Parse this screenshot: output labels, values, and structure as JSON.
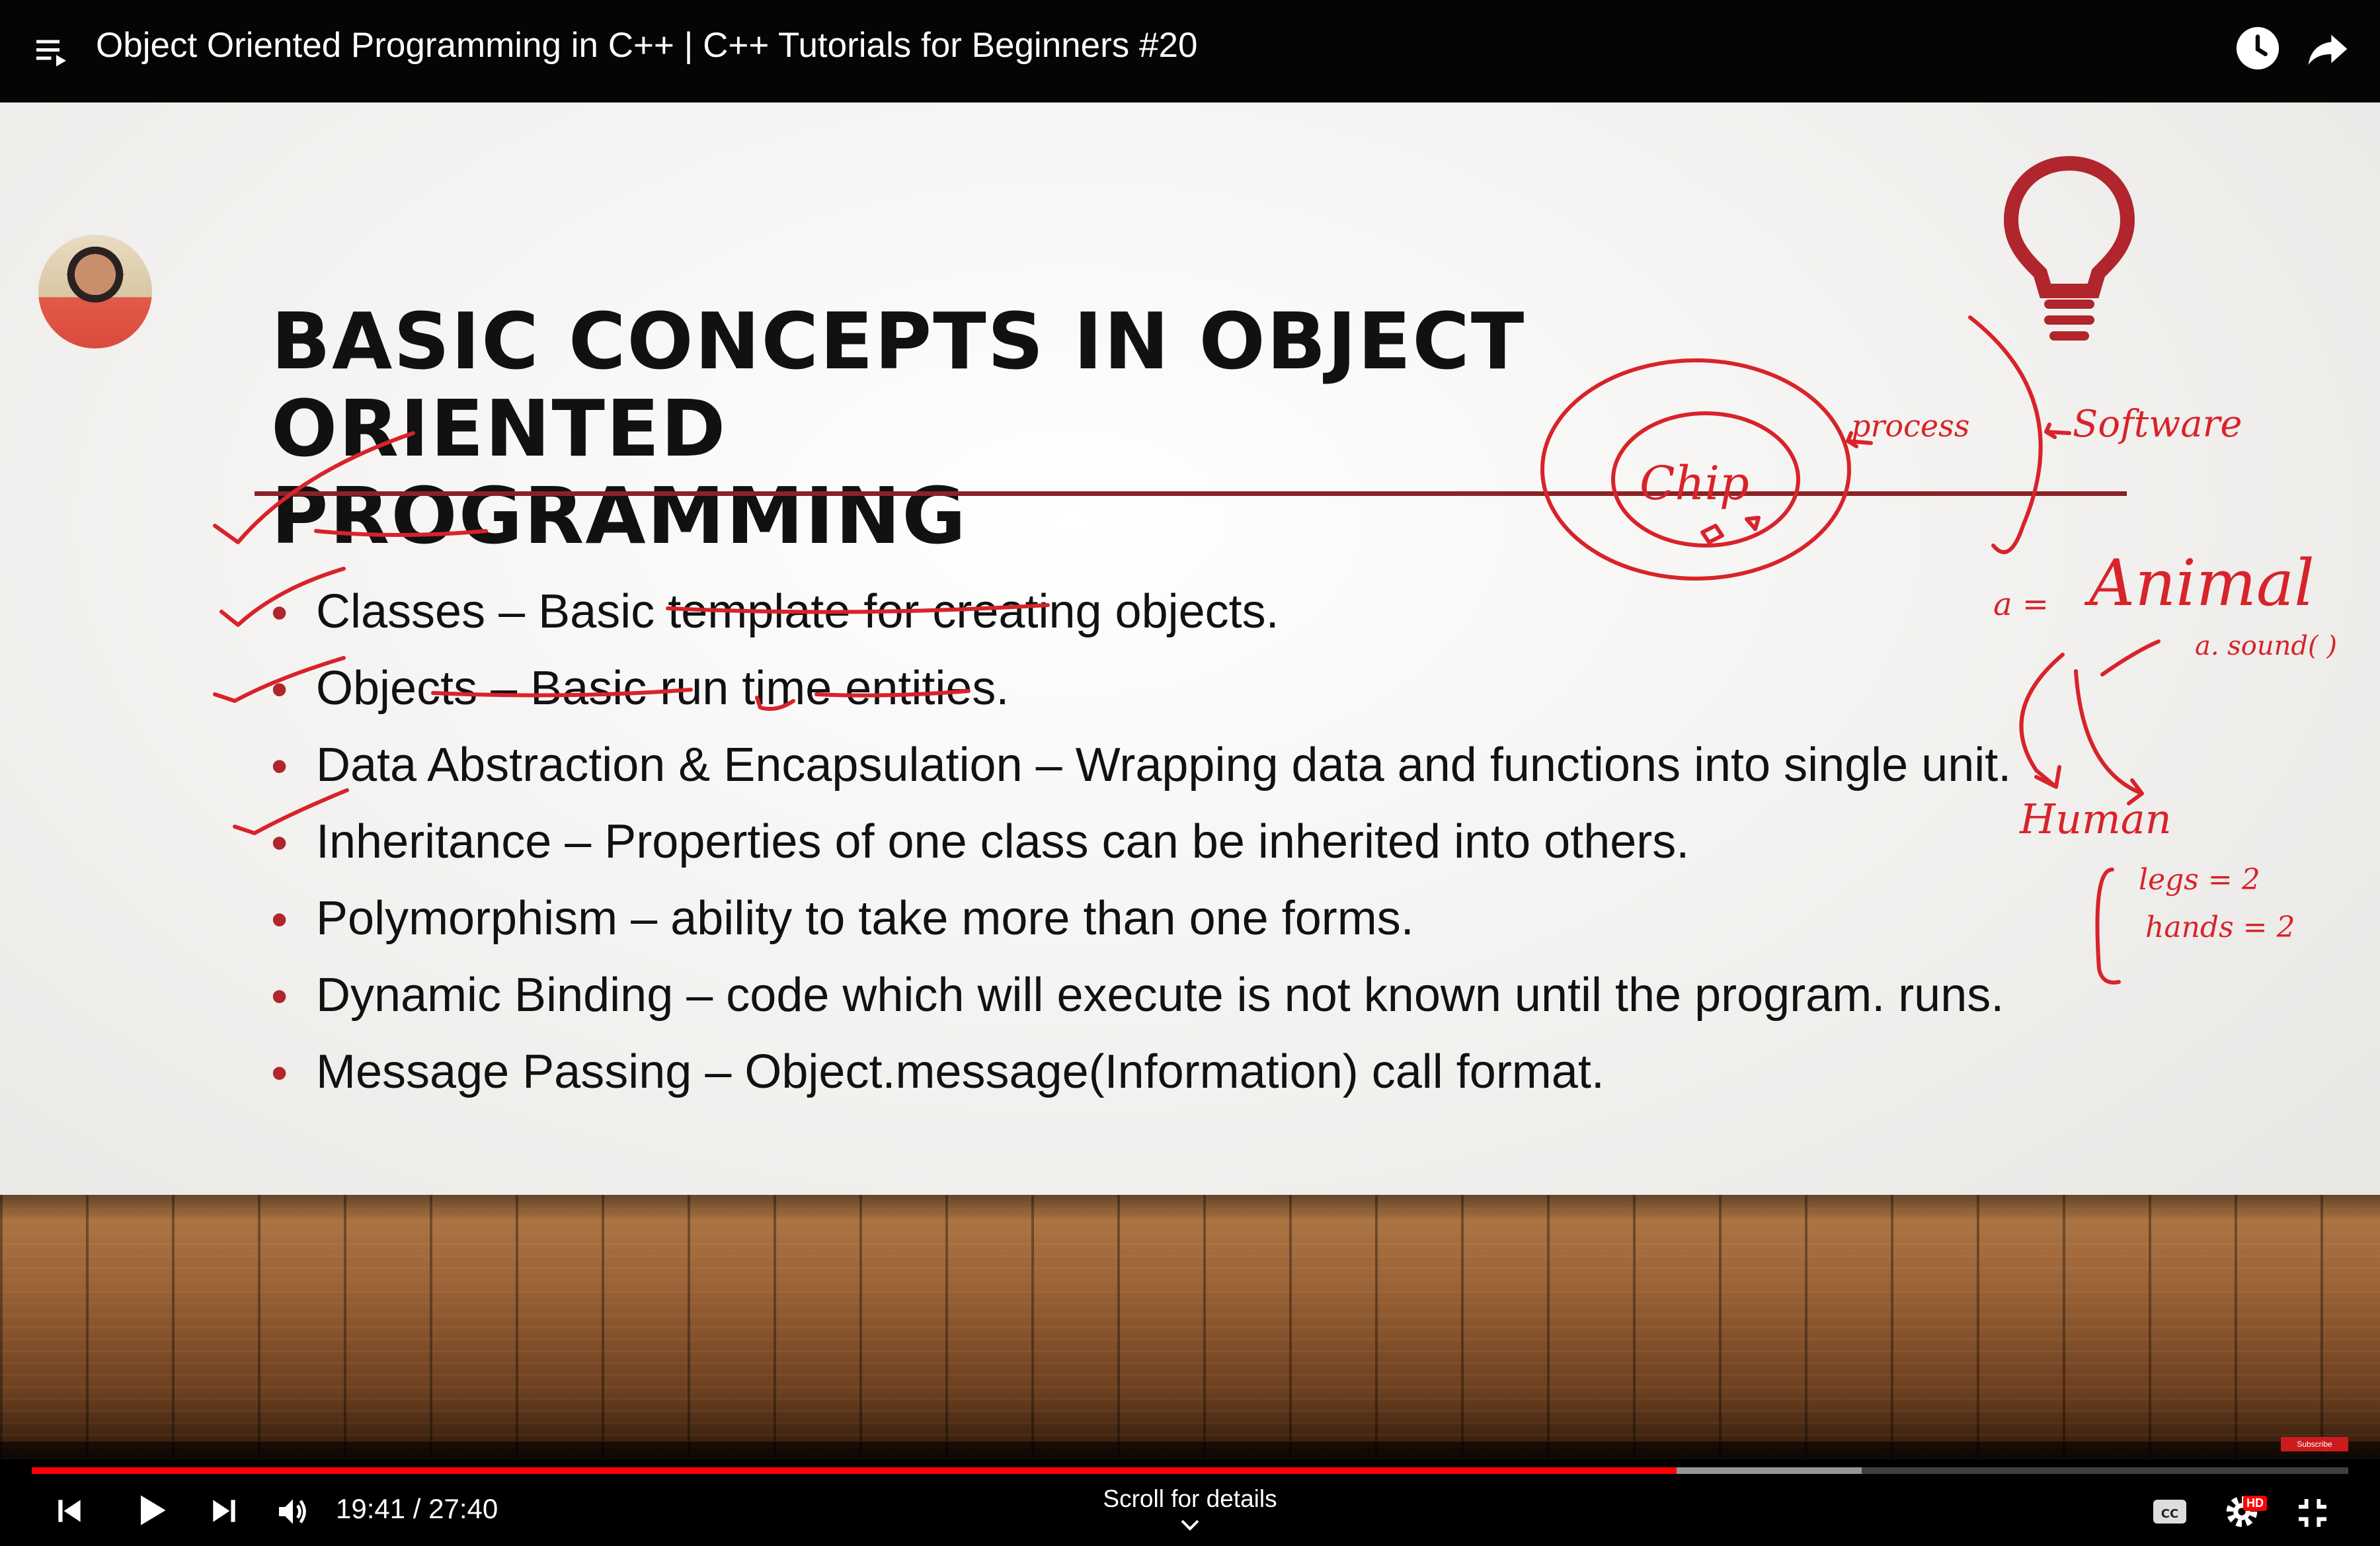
{
  "player": {
    "title": "Object Oriented Programming in C++ | C++ Tutorials for Beginners #20",
    "time": "19:41 / 27:40",
    "progress": 0.71,
    "buffered": 0.79,
    "scroll_hint": "Scroll for details",
    "subscribe_badge": "Subscribe",
    "hd_badge": "HD"
  },
  "slide": {
    "title_line1": "BASIC CONCEPTS IN OBJECT ORIENTED",
    "title_line2": "PROGRAMMING",
    "bullets": [
      {
        "term": "Classes",
        "desc": " – Basic template for creating objects."
      },
      {
        "term": "Objects",
        "desc": " – Basic run time entities."
      },
      {
        "term": "Data Abstraction & Encapsulation",
        "desc": " – Wrapping data and functions into single unit."
      },
      {
        "term": "Inheritance",
        "desc": " – Properties of one class can be inherited into others."
      },
      {
        "term": "Polymorphism",
        "desc": " – ability to take more than one forms."
      },
      {
        "term": "Dynamic Binding",
        "desc": " – code which will execute is not known until the program. runs."
      },
      {
        "term": "Message Passing",
        "desc": " – Object.message(Information) call format."
      }
    ]
  },
  "handwriting": {
    "chip": "Chip",
    "process": "process",
    "software": "Software",
    "a_eq": "a =",
    "animal": "Animal",
    "sound": "a. sound( )",
    "human": "Human",
    "legs": "legs = 2",
    "hands": "hands = 2"
  },
  "icons": {
    "playlist": "playlist-icon",
    "watch_later": "clock-icon",
    "share": "share-icon",
    "prev": "skip-previous-icon",
    "play": "play-icon",
    "next": "skip-next-icon",
    "volume": "volume-icon",
    "captions": "cc-icon",
    "settings": "gear-icon",
    "exit_fullscreen": "exit-fullscreen-icon",
    "lightbulb": "lightbulb-icon"
  },
  "colors": {
    "accent_red": "#b0262c",
    "ink_red": "#d8232a",
    "progress_red": "#ff0000"
  }
}
